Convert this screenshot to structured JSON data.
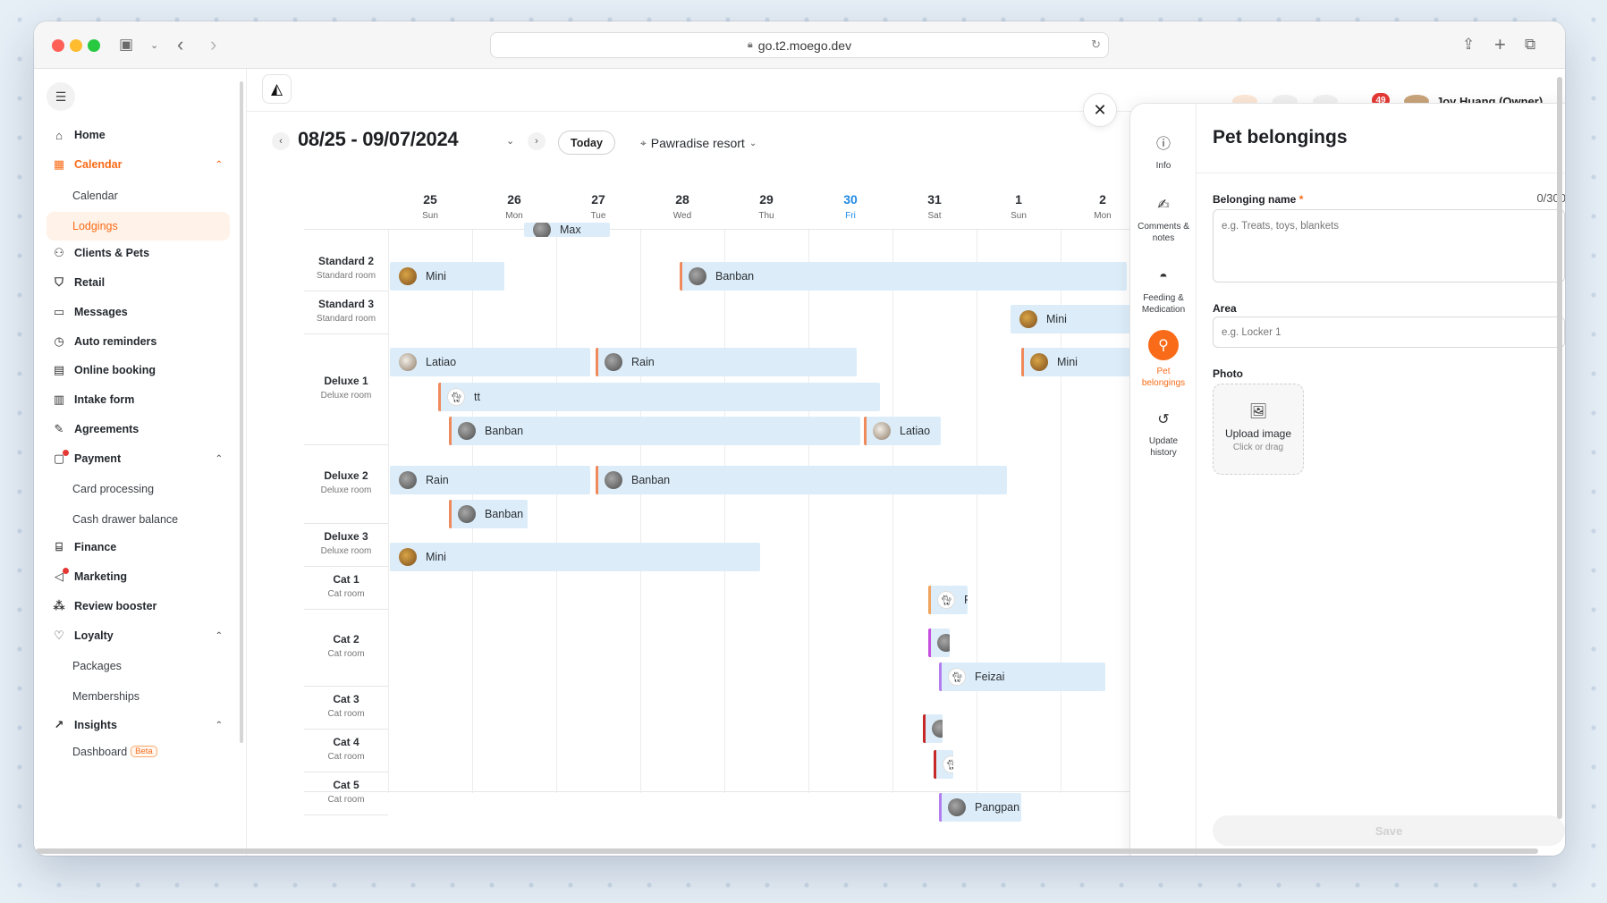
{
  "browser": {
    "url": "go.t2.moego.dev"
  },
  "sidebar": {
    "items": [
      {
        "label": "Home",
        "icon": "home-icon"
      },
      {
        "label": "Calendar",
        "icon": "calendar-icon",
        "active": true,
        "expanded": true
      },
      {
        "label": "Calendar",
        "sub": true
      },
      {
        "label": "Lodgings",
        "sub": true,
        "active": true
      },
      {
        "label": "Clients & Pets",
        "icon": "clients-icon"
      },
      {
        "label": "Retail",
        "icon": "retail-icon"
      },
      {
        "label": "Messages",
        "icon": "messages-icon"
      },
      {
        "label": "Auto reminders",
        "icon": "alarm-icon"
      },
      {
        "label": "Online booking",
        "icon": "online-booking-icon"
      },
      {
        "label": "Intake form",
        "icon": "intake-form-icon"
      },
      {
        "label": "Agreements",
        "icon": "agreements-icon"
      },
      {
        "label": "Payment",
        "icon": "payment-icon",
        "expanded": true,
        "badge_dot": true
      },
      {
        "label": "Card processing",
        "sub": true
      },
      {
        "label": "Cash drawer balance",
        "sub": true
      },
      {
        "label": "Finance",
        "icon": "finance-icon"
      },
      {
        "label": "Marketing",
        "icon": "marketing-icon",
        "badge_dot": true
      },
      {
        "label": "Review booster",
        "icon": "review-booster-icon"
      },
      {
        "label": "Loyalty",
        "icon": "loyalty-icon",
        "expanded": true
      },
      {
        "label": "Packages",
        "sub": true
      },
      {
        "label": "Memberships",
        "sub": true
      },
      {
        "label": "Insights",
        "icon": "insights-icon",
        "expanded": true
      },
      {
        "label": "Dashboard",
        "sub": true,
        "tag": "Beta"
      }
    ]
  },
  "toolbar": {
    "date_range": "08/25 - 09/07/2024",
    "today_label": "Today",
    "location": "Pawradise resort"
  },
  "header_peek": {
    "notification_count": "49",
    "user_name": "Joy Huang (Owner)"
  },
  "days": [
    {
      "num": "25",
      "dow": "Sun"
    },
    {
      "num": "26",
      "dow": "Mon"
    },
    {
      "num": "27",
      "dow": "Tue"
    },
    {
      "num": "28",
      "dow": "Wed"
    },
    {
      "num": "29",
      "dow": "Thu"
    },
    {
      "num": "30",
      "dow": "Fri",
      "today": true
    },
    {
      "num": "31",
      "dow": "Sat"
    },
    {
      "num": "1",
      "dow": "Sun"
    },
    {
      "num": "2",
      "dow": "Mon"
    }
  ],
  "rooms": [
    {
      "name": "Standard 2",
      "type": "Standard room"
    },
    {
      "name": "Standard 3",
      "type": "Standard room"
    },
    {
      "name": "Deluxe 1",
      "type": "Deluxe room"
    },
    {
      "name": "Deluxe 2",
      "type": "Deluxe room"
    },
    {
      "name": "Deluxe 3",
      "type": "Deluxe room"
    },
    {
      "name": "Cat 1",
      "type": "Cat room"
    },
    {
      "name": "Cat 2",
      "type": "Cat room"
    },
    {
      "name": "Cat 3",
      "type": "Cat room"
    },
    {
      "name": "Cat 4",
      "type": "Cat room"
    },
    {
      "name": "Cat 5",
      "type": "Cat room"
    }
  ],
  "bookings": [
    {
      "pet": "Max",
      "avatar": "pet-gray"
    },
    {
      "pet": "Mini",
      "avatar": "pet-dog"
    },
    {
      "pet": "Banban",
      "avatar": "pet-gray",
      "edge_color": "#f08a5d"
    },
    {
      "pet": "Mini",
      "avatar": "pet-dog"
    },
    {
      "pet": "Latiao",
      "avatar": "pet-white"
    },
    {
      "pet": "Rain",
      "avatar": "pet-gray",
      "edge_color": "#f08a5d"
    },
    {
      "pet": "Mini",
      "avatar": "pet-dog",
      "edge_color": "#f08a5d"
    },
    {
      "pet": "tt",
      "avatar": "pet-cat",
      "edge_color": "#f08a5d"
    },
    {
      "pet": "Banban",
      "avatar": "pet-gray",
      "edge_color": "#f08a5d"
    },
    {
      "pet": "Latiao",
      "avatar": "pet-white",
      "edge_color": "#f08a5d"
    },
    {
      "pet": "Rain",
      "avatar": "pet-gray"
    },
    {
      "pet": "Banban",
      "avatar": "pet-gray",
      "edge_color": "#f08a5d"
    },
    {
      "pet": "Banban",
      "avatar": "pet-gray",
      "edge_color": "#f08a5d"
    },
    {
      "pet": "Mini",
      "avatar": "pet-dog"
    },
    {
      "pet": "F",
      "avatar": "pet-cat",
      "edge_color": "#f0a35d"
    },
    {
      "pet": "",
      "avatar": "pet-gray",
      "edge_color": "#c64fe0"
    },
    {
      "pet": "Feizai",
      "avatar": "pet-cat",
      "edge_color": "#b37df0"
    },
    {
      "pet": "",
      "avatar": "pet-gray",
      "edge_color": "#c62828"
    },
    {
      "pet": "",
      "avatar": "pet-cat",
      "edge_color": "#c62828"
    },
    {
      "pet": "Pangpan",
      "avatar": "pet-gray",
      "edge_color": "#b37df0"
    }
  ],
  "panel": {
    "tabs": [
      {
        "label": "Info",
        "icon": "info-icon"
      },
      {
        "label": "Comments & notes",
        "icon": "comments-icon"
      },
      {
        "label": "Feeding & Medication",
        "icon": "feeding-icon"
      },
      {
        "label": "Pet belongings",
        "icon": "pet-belongings-icon",
        "active": true
      },
      {
        "label": "Update history",
        "icon": "history-icon"
      }
    ],
    "title": "Pet belongings",
    "belonging_name_label": "Belonging name",
    "belonging_name_required": "*",
    "belonging_name_count": "0/300",
    "belonging_name_placeholder": "e.g. Treats, toys, blankets",
    "area_label": "Area",
    "area_placeholder": "e.g. Locker 1",
    "photo_label": "Photo",
    "upload_title": "Upload image",
    "upload_sub": "Click or drag",
    "save_label": "Save"
  },
  "colors": {
    "accent": "#f96b18",
    "today": "#1e88e5",
    "booking_fill": "#dcedf9"
  }
}
